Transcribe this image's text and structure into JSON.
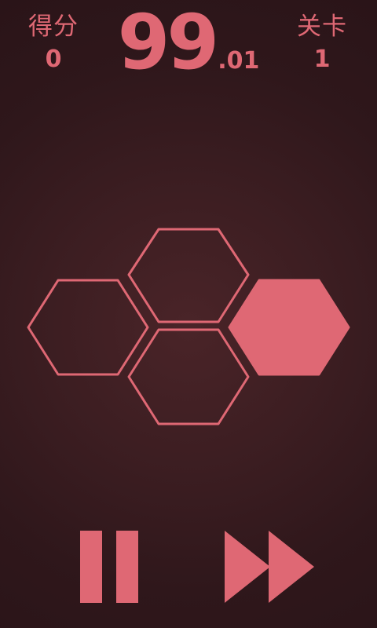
{
  "hud": {
    "score_label": "得分",
    "score_value": "0",
    "timer_main": "99",
    "timer_fraction": ".01",
    "level_label": "关卡",
    "level_value": "1"
  },
  "board": {
    "hex_color": "#df6874",
    "tiles": [
      {
        "name": "hex-tile-top",
        "filled": false
      },
      {
        "name": "hex-tile-left",
        "filled": false
      },
      {
        "name": "hex-tile-bottom",
        "filled": false
      },
      {
        "name": "hex-tile-right",
        "filled": true
      }
    ]
  },
  "controls": {
    "pause_icon": "pause-icon",
    "fast_forward_icon": "fast-forward-icon"
  },
  "colors": {
    "accent": "#df6874",
    "background": "#3b1d21"
  }
}
